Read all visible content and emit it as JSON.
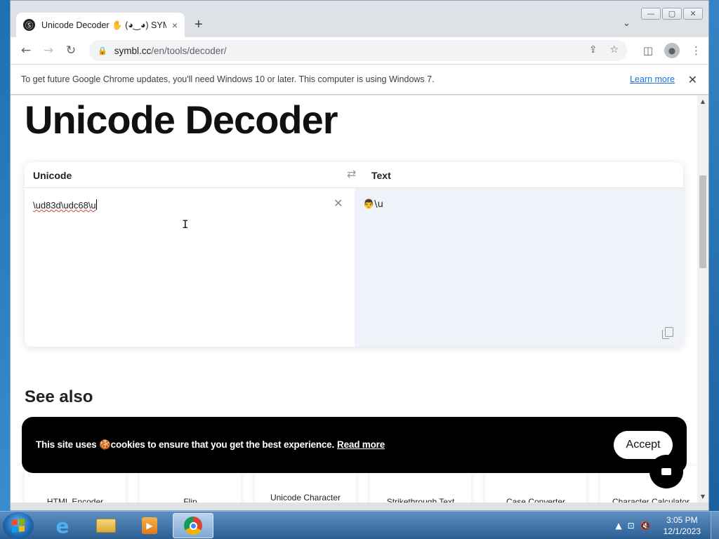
{
  "browser": {
    "tab_title": "Unicode Decoder ✋ (◕‿◕) SYM",
    "tab_close": "×",
    "new_tab": "+",
    "tab_search": "⌄",
    "url_host": "symbl.cc",
    "url_path": "/en/tools/decoder/",
    "back": "←",
    "forward": "→",
    "reload": "↻",
    "lock": "🔒",
    "share": "⇪",
    "star": "☆",
    "sidepanel": "◫",
    "menu": "⋮",
    "profile": "👤"
  },
  "window_controls": {
    "minimize": "—",
    "maximize": "▢",
    "close": "✕"
  },
  "infobar": {
    "message": "To get future Google Chrome updates, you'll need Windows 10 or later. This computer is using Windows 7.",
    "learn_more": "Learn more",
    "close": "✕"
  },
  "page": {
    "title": "Unicode Decoder",
    "decoder": {
      "input_label": "Unicode",
      "output_label": "Text",
      "swap": "⇄",
      "input_value": "\\ud83d\\udc68\\u",
      "clear": "✕",
      "output_value": "👨\\u"
    },
    "see_also": "See also",
    "cards": [
      {
        "label": "HTML Encoder"
      },
      {
        "label": "Flip"
      },
      {
        "label": "Unicode Character"
      },
      {
        "label": "Strikethrough Text"
      },
      {
        "label": "Case Converter"
      },
      {
        "label": "Character Calculator"
      }
    ],
    "cookie": {
      "text": "This site uses 🍪cookies to ensure that you get the best experience.",
      "read_more": "Read more",
      "accept": "Accept"
    }
  },
  "taskbar": {
    "clock_time": "3:05 PM",
    "clock_date": "12/1/2023",
    "items": [
      "internet-explorer",
      "file-explorer",
      "media-player",
      "chrome"
    ],
    "tray_icons": [
      "▲",
      "⊡",
      "🔇"
    ]
  },
  "colors": {
    "accent_link": "#1a73e8",
    "output_bg": "#eff3f9",
    "cookie_bg": "#000000",
    "taskbar": "#2c5f94"
  }
}
